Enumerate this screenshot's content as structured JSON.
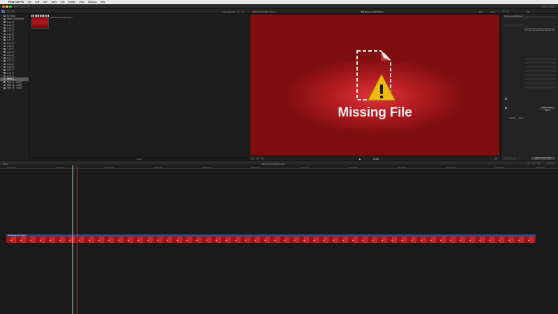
{
  "menubar": {
    "app_name": "Final Cut Pro",
    "items": [
      "File",
      "Edit",
      "Trim",
      "Mark",
      "Clip",
      "Modify",
      "View",
      "Window",
      "Help"
    ]
  },
  "sidebar": {
    "items": [
      {
        "label": "Full Year",
        "selected": false
      },
      {
        "label": "Smart Collections",
        "selected": false
      },
      {
        "label": "1-10-17",
        "selected": false
      },
      {
        "label": "1-11-17",
        "selected": false
      },
      {
        "label": "1-12-17",
        "selected": false
      },
      {
        "label": "1-13-17",
        "selected": false
      },
      {
        "label": "1-14-17",
        "selected": false
      },
      {
        "label": "1-15-17",
        "selected": false
      },
      {
        "label": "1-16-17",
        "selected": false
      },
      {
        "label": "1-17-17",
        "selected": false
      },
      {
        "label": "1-18-17",
        "selected": false
      },
      {
        "label": "1-19-17",
        "selected": false
      },
      {
        "label": "1-20-17",
        "selected": false
      },
      {
        "label": "1-21-17",
        "selected": false
      },
      {
        "label": "1-22-17",
        "selected": false
      },
      {
        "label": "1-23-17",
        "selected": false
      },
      {
        "label": "1-24-17",
        "selected": false
      },
      {
        "label": "1-25-17",
        "selected": false
      },
      {
        "label": "1-26-17",
        "selected": false
      },
      {
        "label": "1-27-17",
        "selected": false
      },
      {
        "label": "1-28-17",
        "selected": false
      },
      {
        "label": "Week 1",
        "selected": true
      },
      {
        "label": "Sept 11 - Oct25",
        "selected": false
      },
      {
        "label": "Sept 18 - Oct25",
        "selected": false
      },
      {
        "label": "Sept 25 - Oct25",
        "selected": false
      }
    ]
  },
  "browser": {
    "footer": "1 item"
  },
  "viewer": {
    "header_left": "Hide Rejected",
    "header_center": "1080p HD 23.98p, Stereo",
    "header_title": "365 Reverse Full Project",
    "zoom": "64%",
    "view_label": "View",
    "missing_text": "Missing File",
    "timecode": "2:24"
  },
  "inspector": {
    "header": "Info",
    "name_field": "365 Reverse Full Project",
    "notes_value": "365 Reverse Full Project - click here to see all of every clip we shot with the 2017 year",
    "apply_label": "Apply Custom Name",
    "original_label": "Original",
    "proxy_label": "Proxy"
  },
  "timeline": {
    "header_left": "Index",
    "header_center": "365 Reverse Full Project",
    "clip_label": "365 Reverse Full Project",
    "ruler_ticks": [
      "00:00:00:00",
      "00:00:10:00",
      "00:00:20:00",
      "00:00:30:00",
      "00:00:40:00",
      "00:00:50:00",
      "00:01:00:00",
      "00:01:10:00",
      "00:01:20:00",
      "00:01:30:00",
      "00:01:40:00",
      "00:01:50:00"
    ]
  },
  "colors": {
    "accent_red": "#b51d22",
    "clip_blue": "#2e4d8a",
    "playhead_red": "#c0392b"
  }
}
